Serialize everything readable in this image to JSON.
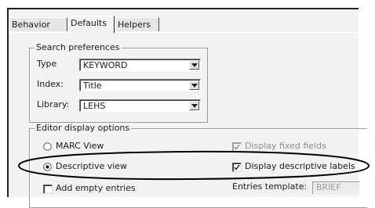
{
  "tabs": [
    {
      "label": "Behavior",
      "active": false
    },
    {
      "label": "Defaults",
      "active": true
    },
    {
      "label": "Helpers",
      "active": false
    }
  ],
  "search_preferences": {
    "title": "Search preferences",
    "fields": [
      {
        "label": "Type",
        "value": "KEYWORD",
        "icon": "chevron-down-icon"
      },
      {
        "label": "Index:",
        "value": "Title",
        "icon": "chevron-down-icon"
      },
      {
        "label": "Library:",
        "value": "LEHS",
        "icon": "chevron-down-icon"
      }
    ]
  },
  "editor_display_options": {
    "title": "Editor display options",
    "marc_view": {
      "label": "MARC View",
      "selected": false
    },
    "descriptive_view": {
      "label": "Descriptive view",
      "selected": true
    },
    "display_fixed_fields": {
      "label": "Display fixed fields",
      "checked": true,
      "enabled": false
    },
    "display_descriptive_labels": {
      "label": "Display descriptive labels",
      "checked": true,
      "enabled": true
    },
    "add_empty_entries": {
      "label": "Add empty entries",
      "checked": false
    },
    "entries_template": {
      "label": "Entries template:",
      "value": "BRIEF",
      "enabled": false
    }
  },
  "colors": {
    "panel": "#f2f2f2",
    "annotation": "#000000"
  }
}
